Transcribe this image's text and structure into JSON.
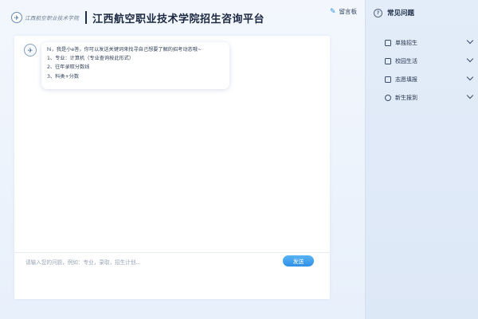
{
  "header": {
    "logo_text": "江西航空职业技术学院",
    "title": "江西航空职业技术学院招生咨询平台",
    "board_label": "留言板"
  },
  "chat": {
    "message_lines": [
      "hi，我是小e答，你可以发送关键词来找寻自己想要了解的招考动态哦~",
      "1、专业：计算机（专业查询按此形式）",
      "2、往年录取分数线",
      "3、科类+分数"
    ],
    "input_placeholder": "请输入您的问题，例如：专业，录取，招生计划...",
    "send_label": "发送"
  },
  "sidebar": {
    "title": "常见问题",
    "items": [
      {
        "label": "单独招生",
        "icon": "enrollment-icon"
      },
      {
        "label": "校园生活",
        "icon": "campus-icon"
      },
      {
        "label": "志愿填报",
        "icon": "application-icon"
      },
      {
        "label": "新生报到",
        "icon": "user-icon"
      }
    ]
  },
  "colors": {
    "accent": "#2f8fe6",
    "title_text": "#1b2740",
    "sidebar_bg": "#e3ecf9"
  }
}
